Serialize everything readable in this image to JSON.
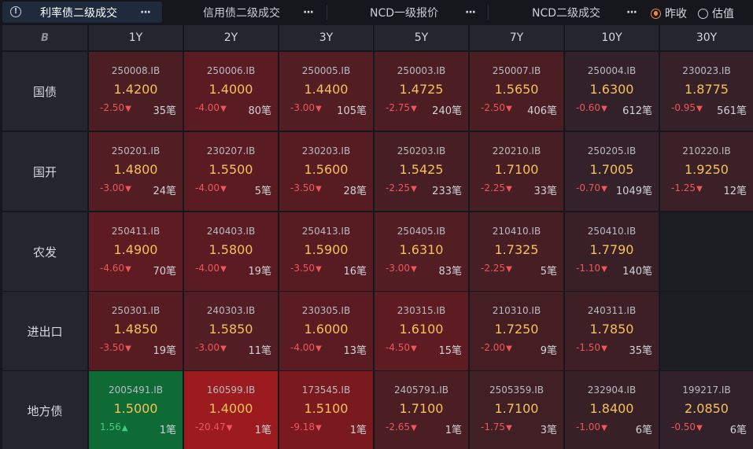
{
  "tabs": [
    {
      "label": "利率债二级成交",
      "more": "···",
      "active": true
    },
    {
      "label": "信用债二级成交",
      "more": "···",
      "active": false
    },
    {
      "label": "NCD一级报价",
      "more": "···",
      "active": false
    },
    {
      "label": "NCD二级成交",
      "more": "···",
      "active": false
    }
  ],
  "info_icon": "info-icon",
  "radio": [
    {
      "label": "昨收",
      "selected": true
    },
    {
      "label": "估值",
      "selected": false
    }
  ],
  "corner_logo": "B",
  "tenors": [
    "1Y",
    "2Y",
    "3Y",
    "5Y",
    "7Y",
    "10Y",
    "30Y"
  ],
  "rows": [
    {
      "label": "国债",
      "cells": [
        {
          "code": "250008.IB",
          "rate": "1.4200",
          "change": "-2.50",
          "dir": "down",
          "count": "35笔",
          "bg": "#4a1e23"
        },
        {
          "code": "250006.IB",
          "rate": "1.4000",
          "change": "-4.00",
          "dir": "down",
          "count": "80笔",
          "bg": "#5a1c22"
        },
        {
          "code": "250005.IB",
          "rate": "1.4400",
          "change": "-3.00",
          "dir": "down",
          "count": "105笔",
          "bg": "#521d23"
        },
        {
          "code": "250003.IB",
          "rate": "1.4725",
          "change": "-2.75",
          "dir": "down",
          "count": "240笔",
          "bg": "#4c1e23"
        },
        {
          "code": "250007.IB",
          "rate": "1.5650",
          "change": "-2.50",
          "dir": "down",
          "count": "406笔",
          "bg": "#4a1e23"
        },
        {
          "code": "250004.IB",
          "rate": "1.6300",
          "change": "-0.60",
          "dir": "down",
          "count": "612笔",
          "bg": "#33212a"
        },
        {
          "code": "230023.IB",
          "rate": "1.8775",
          "change": "-0.95",
          "dir": "down",
          "count": "561笔",
          "bg": "#372128"
        }
      ]
    },
    {
      "label": "国开",
      "cells": [
        {
          "code": "250201.IB",
          "rate": "1.4800",
          "change": "-3.00",
          "dir": "down",
          "count": "24笔",
          "bg": "#521d23"
        },
        {
          "code": "230207.IB",
          "rate": "1.5500",
          "change": "-4.00",
          "dir": "down",
          "count": "5笔",
          "bg": "#5a1c22"
        },
        {
          "code": "230203.IB",
          "rate": "1.5600",
          "change": "-3.50",
          "dir": "down",
          "count": "28笔",
          "bg": "#561c22"
        },
        {
          "code": "250203.IB",
          "rate": "1.5425",
          "change": "-2.25",
          "dir": "down",
          "count": "233笔",
          "bg": "#471e24"
        },
        {
          "code": "220210.IB",
          "rate": "1.7100",
          "change": "-2.25",
          "dir": "down",
          "count": "33笔",
          "bg": "#471e24"
        },
        {
          "code": "250205.IB",
          "rate": "1.7005",
          "change": "-0.70",
          "dir": "down",
          "count": "1049笔",
          "bg": "#34212a"
        },
        {
          "code": "210220.IB",
          "rate": "1.9250",
          "change": "-1.25",
          "dir": "down",
          "count": "12笔",
          "bg": "#3b2027"
        }
      ]
    },
    {
      "label": "农发",
      "cells": [
        {
          "code": "250411.IB",
          "rate": "1.4900",
          "change": "-4.60",
          "dir": "down",
          "count": "70笔",
          "bg": "#5e1b21"
        },
        {
          "code": "240403.IB",
          "rate": "1.5800",
          "change": "-4.00",
          "dir": "down",
          "count": "19笔",
          "bg": "#5a1c22"
        },
        {
          "code": "250413.IB",
          "rate": "1.5900",
          "change": "-3.50",
          "dir": "down",
          "count": "16笔",
          "bg": "#561c22"
        },
        {
          "code": "250405.IB",
          "rate": "1.6310",
          "change": "-3.00",
          "dir": "down",
          "count": "83笔",
          "bg": "#521d23"
        },
        {
          "code": "210410.IB",
          "rate": "1.7325",
          "change": "-2.25",
          "dir": "down",
          "count": "5笔",
          "bg": "#471e24"
        },
        {
          "code": "250410.IB",
          "rate": "1.7790",
          "change": "-1.10",
          "dir": "down",
          "count": "140笔",
          "bg": "#392027"
        },
        null
      ]
    },
    {
      "label": "进出口",
      "cells": [
        {
          "code": "250301.IB",
          "rate": "1.4850",
          "change": "-3.50",
          "dir": "down",
          "count": "19笔",
          "bg": "#561c22"
        },
        {
          "code": "240303.IB",
          "rate": "1.5850",
          "change": "-3.00",
          "dir": "down",
          "count": "11笔",
          "bg": "#521d23"
        },
        {
          "code": "230305.IB",
          "rate": "1.6000",
          "change": "-4.00",
          "dir": "down",
          "count": "13笔",
          "bg": "#5a1c22"
        },
        {
          "code": "230315.IB",
          "rate": "1.6100",
          "change": "-4.50",
          "dir": "down",
          "count": "15笔",
          "bg": "#5e1b21"
        },
        {
          "code": "210310.IB",
          "rate": "1.7250",
          "change": "-2.00",
          "dir": "down",
          "count": "9笔",
          "bg": "#451e24"
        },
        {
          "code": "240311.IB",
          "rate": "1.7850",
          "change": "-1.50",
          "dir": "down",
          "count": "35笔",
          "bg": "#3e1f26"
        },
        null
      ]
    },
    {
      "label": "地方债",
      "cells": [
        {
          "code": "2005491.IB",
          "rate": "1.5000",
          "change": "1.56",
          "dir": "up",
          "count": "1笔",
          "bg": "#0f6b35"
        },
        {
          "code": "160599.IB",
          "rate": "1.4000",
          "change": "-20.47",
          "dir": "down",
          "count": "1笔",
          "bg": "#9c1b1f"
        },
        {
          "code": "173545.IB",
          "rate": "1.5100",
          "change": "-9.18",
          "dir": "down",
          "count": "1笔",
          "bg": "#7a1a1f"
        },
        {
          "code": "2405791.IB",
          "rate": "1.7100",
          "change": "-2.65",
          "dir": "down",
          "count": "1笔",
          "bg": "#4b1e23"
        },
        {
          "code": "2505359.IB",
          "rate": "1.7100",
          "change": "-1.75",
          "dir": "down",
          "count": "3笔",
          "bg": "#401f25"
        },
        {
          "code": "232904.IB",
          "rate": "1.8400",
          "change": "-1.00",
          "dir": "down",
          "count": "6笔",
          "bg": "#382027"
        },
        {
          "code": "199217.IB",
          "rate": "2.0850",
          "change": "-0.50",
          "dir": "down",
          "count": "6笔",
          "bg": "#32212a"
        }
      ]
    }
  ],
  "arrows": {
    "down": "▼",
    "up": "▲"
  }
}
